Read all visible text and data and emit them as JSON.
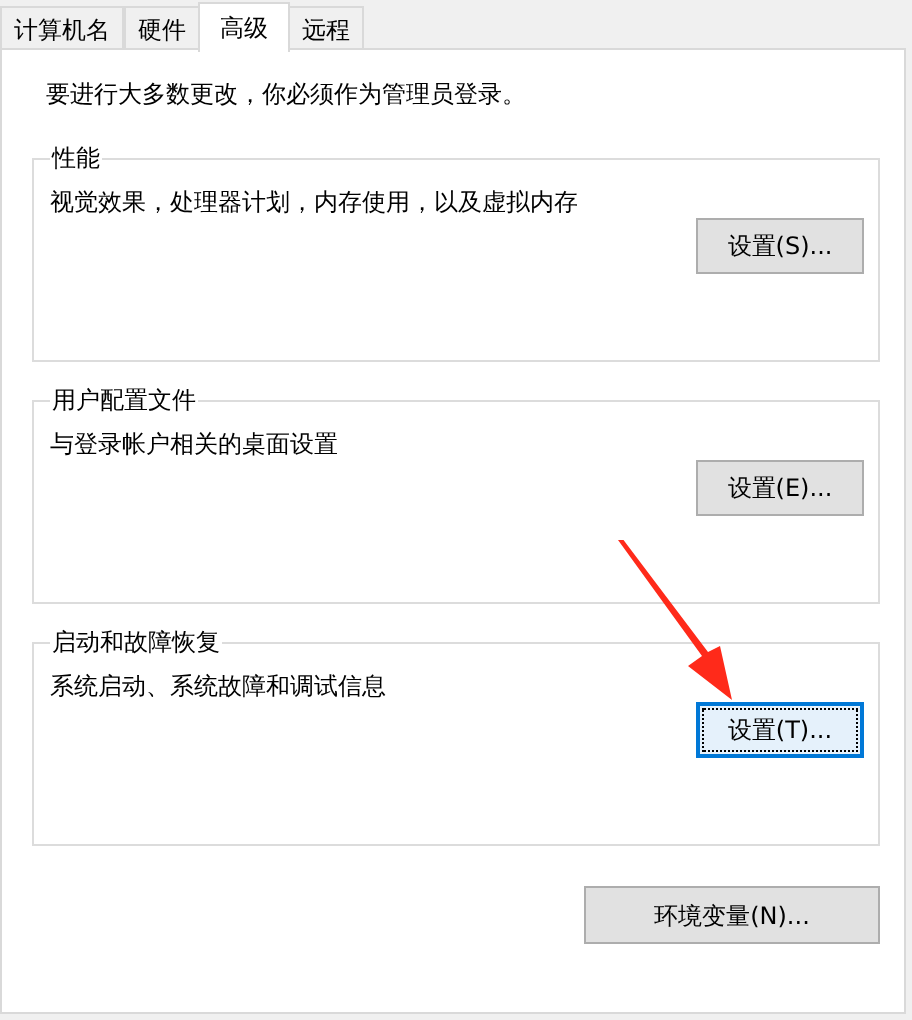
{
  "tabs": [
    {
      "label": "计算机名",
      "selected": false
    },
    {
      "label": "硬件",
      "selected": false
    },
    {
      "label": "高级",
      "selected": true
    },
    {
      "label": "远程",
      "selected": false
    }
  ],
  "notice": "要进行大多数更改，你必须作为管理员登录。",
  "groups": [
    {
      "title": "性能",
      "description": "视觉效果，处理器计划，内存使用，以及虚拟内存",
      "button": {
        "label": "设置(S)...",
        "focused": false
      }
    },
    {
      "title": "用户配置文件",
      "description": "与登录帐户相关的桌面设置",
      "button": {
        "label": "设置(E)...",
        "focused": false
      }
    },
    {
      "title": "启动和故障恢复",
      "description": "系统启动、系统故障和调试信息",
      "button": {
        "label": "设置(T)...",
        "focused": true
      }
    }
  ],
  "env_button": "环境变量(N)..."
}
